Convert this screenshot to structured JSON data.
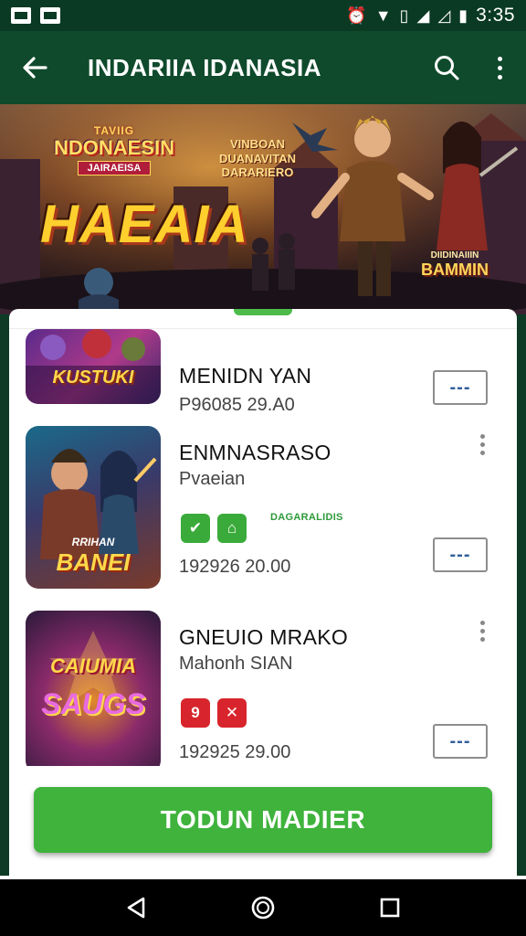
{
  "status_bar": {
    "time": "3:35"
  },
  "app_bar": {
    "title": "INDARIIA IDANASIA"
  },
  "banner": {
    "logo_line1": "TAVIIG",
    "logo_line2": "NDONAESIN",
    "logo_line3": "JAIRAEISA",
    "subtitle": "VINBOAN DUANAVITAN DARARIERO",
    "headline": "HAEAIA",
    "corner_small": "DIIDINAIIIN",
    "corner_big": "BAMMIN"
  },
  "items": [
    {
      "thumb_text": "KUSTUKI",
      "title": "MENIDN YAN",
      "meta": "P96085 29.A0",
      "action_label": "---"
    },
    {
      "thumb_text": "BANEI",
      "thumb_small": "RRIHAN",
      "title": "ENMNASRASO",
      "subtitle": "Pvaeian",
      "chips_label": "DAGARALIDIS",
      "meta": "192926 20.00",
      "action_label": "---"
    },
    {
      "thumb_text": "SAUGS",
      "thumb_small": "CAIUMIA",
      "title": "GNEUIO MRAKO",
      "subtitle": "Mahonh SIAN",
      "meta": "192925 29.00",
      "action_label": "---"
    }
  ],
  "cta": {
    "label": "TODUN MADIER"
  },
  "colors": {
    "accent": "#3fb33c",
    "app_bar": "#0f4a2c",
    "status_bar": "#0b3a24"
  }
}
